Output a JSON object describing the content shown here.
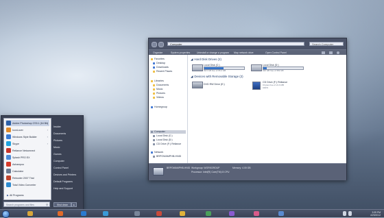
{
  "explorer": {
    "address": "Computer",
    "search_placeholder": "Search Computer",
    "toolbar": [
      "Organize",
      "System properties",
      "Uninstall or change a program",
      "Map network drive",
      "Open Control Panel"
    ],
    "nav": {
      "favorites": "Favorites",
      "desktop": "Desktop",
      "downloads": "Downloads",
      "recent_places": "Recent Places",
      "libraries": "Libraries",
      "documents": "Documents",
      "music": "Music",
      "pictures": "Pictures",
      "videos": "Videos",
      "homegroup": "Homegroup",
      "computer": "Computer",
      "local_c": "Local Disk (C:)",
      "local_d": "Local Disk (D:)",
      "cd_f": "CD Drive (F:) Reliance",
      "network": "Network",
      "network_pc": "BRPOWAMPHB-HNID"
    },
    "groups": {
      "hard_disk": "Hard Disk Drives (2)",
      "removable": "Devices with Removable Storage (2)"
    },
    "drives": [
      {
        "name": "Local Disk (C:)",
        "free": "49.6 GB free of 95.4 GB",
        "used_fraction": 0.48
      },
      {
        "name": "Local Disk (D:)",
        "free": "320 GB free of 352 GB",
        "used_fraction": 0.09
      }
    ],
    "removable": [
      {
        "name": "DVD RW Drive (E:)"
      },
      {
        "name": "CD Drive (F:) Reliance",
        "line2": "0 bytes free of 21.6 MB",
        "line3": "CDFS"
      }
    ],
    "status": {
      "name": "BRPOWAMPHB-HNID",
      "workgroup": "Workgroup: WORKGROUP",
      "memory": "Memory: 4.00 GB",
      "processor": "Processor: Intel(R) Core(TM) i3 CPU"
    }
  },
  "start_menu": {
    "programs": [
      {
        "label": "Adobe Photoshop CS5.1 (64 Bit)",
        "icon_color": "#2b5fa8"
      },
      {
        "label": "IconLover",
        "icon_color": "#e08a2a"
      },
      {
        "label": "Windows Style Builder",
        "icon_color": "#3a7bd5"
      },
      {
        "label": "Skype",
        "icon_color": "#1fa3e0"
      },
      {
        "label": "Reliance Netconnect",
        "icon_color": "#c8342a"
      },
      {
        "label": "Splash PRO EX",
        "icon_color": "#4a8ad8"
      },
      {
        "label": "Ashampoo",
        "icon_color": "#d63a2a"
      },
      {
        "label": "Calculator",
        "icon_color": "#6a7a92"
      },
      {
        "label": "Rebooter 2007 Trial",
        "icon_color": "#c0452f"
      },
      {
        "label": "Total Video Converter",
        "icon_color": "#2c8ad0"
      }
    ],
    "all_programs": "All Programs",
    "search_placeholder": "Search programs and files",
    "right_items": [
      "Insider",
      "Documents",
      "Pictures",
      "Music",
      "Games",
      "Computer",
      "Control Panel",
      "Devices and Printers",
      "Default Programs",
      "Help and Support"
    ],
    "shutdown": "Shut down",
    "shutdown_arrow": "▸"
  },
  "taskbar": {
    "time": "3:39 PM",
    "date": "4/29/2012"
  }
}
